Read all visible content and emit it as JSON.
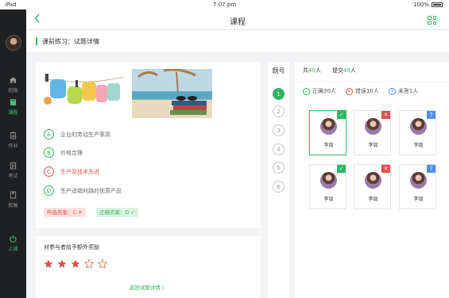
{
  "status_bar": {
    "left": "iPad",
    "time": "7:07 pm",
    "battery": "100%"
  },
  "header": {
    "title": "课程"
  },
  "breadcrumb": {
    "text": "课前练习：试题详情"
  },
  "sidebar": {
    "items": [
      {
        "label": "班级",
        "icon": "class-icon"
      },
      {
        "label": "课程",
        "icon": "book-icon",
        "active": true
      },
      {
        "label": "作业",
        "icon": "homework-icon"
      },
      {
        "label": "考试",
        "icon": "exam-icon"
      },
      {
        "label": "拓展",
        "icon": "bookmark-icon"
      },
      {
        "label": "上课",
        "icon": "power-icon"
      }
    ]
  },
  "question": {
    "options": [
      {
        "letter": "A",
        "text": "企业的劳动生产率高"
      },
      {
        "letter": "B",
        "text": "价格合理"
      },
      {
        "letter": "C",
        "text": "生产及技术先进",
        "wrong": true
      },
      {
        "letter": "D",
        "text": "生产适销对路的优质产品"
      }
    ],
    "selected_answer": "所选答案：C ✕",
    "correct_answer": "正确答案：D ✓"
  },
  "reward": {
    "title": "对参与者给予额外奖励",
    "rating": 3,
    "max": 5,
    "link": "返回试题详情  〉"
  },
  "numbers": {
    "header": "题号",
    "items": [
      "1",
      "2",
      "3",
      "4",
      "5",
      "6"
    ],
    "active_index": 0
  },
  "stats": {
    "total_label": "共",
    "total": "40",
    "unit": "人",
    "submitted_label": "提交",
    "submitted": "40",
    "correct": "正确30人",
    "wrong": "错误10人",
    "unanswered": "未答1人"
  },
  "students": [
    {
      "name": "李诞",
      "status": "correct"
    },
    {
      "name": "李诞",
      "status": "wrong"
    },
    {
      "name": "李诞",
      "status": "unanswered"
    },
    {
      "name": "李诞",
      "status": "correct"
    },
    {
      "name": "李诞",
      "status": "wrong"
    },
    {
      "name": "李诞",
      "status": "unanswered"
    }
  ],
  "colors": {
    "accent": "#2fb564",
    "error": "#e0504a",
    "info": "#4b8ff0",
    "sidebar": "#1f2022"
  }
}
